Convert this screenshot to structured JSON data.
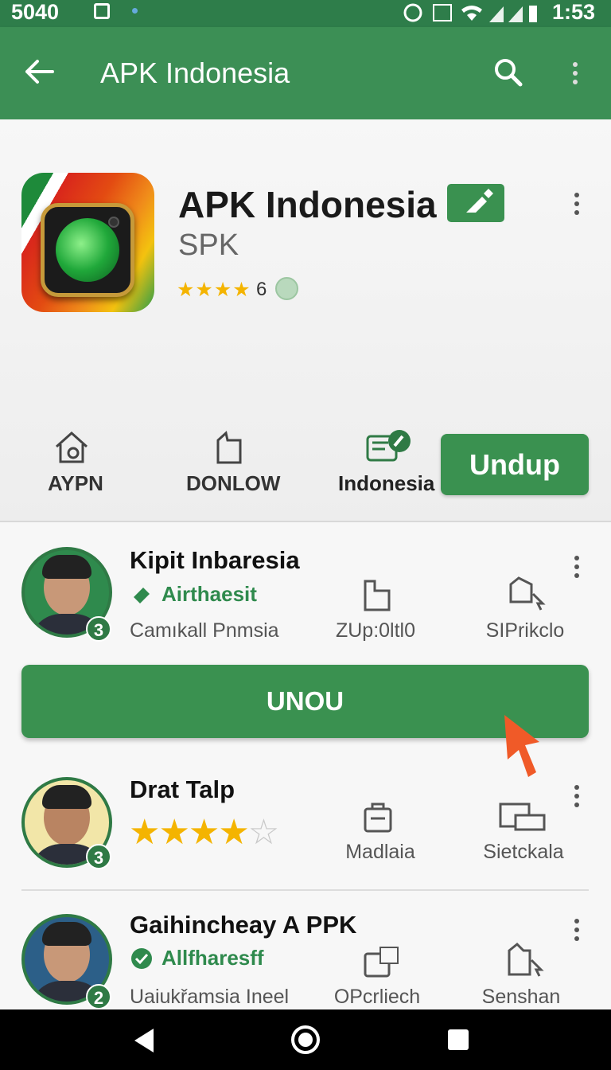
{
  "status_bar": {
    "left": "5040",
    "time": "1:53"
  },
  "app_bar": {
    "title": "APK Indonesia",
    "back": "back-icon",
    "search": "search-icon",
    "menu": "more-icon"
  },
  "app": {
    "name": "APK Indonesia",
    "developer": "SPK",
    "rating": "6",
    "star_count": 4,
    "tabs": [
      {
        "label": "AYPN",
        "icon": "home-icon"
      },
      {
        "label": "DONLOW",
        "icon": "page-icon"
      },
      {
        "label": "Indonesia",
        "icon": "edit-icon"
      }
    ],
    "install_label": "Undup"
  },
  "items": [
    {
      "name": "Kipit Inbaresia",
      "tag": "Airthaesit",
      "desc": "Camıkall Pnmsia",
      "col1": "ZUp:0ltl0",
      "col2": "SIPrikclo",
      "badge": "3"
    },
    {
      "name": "Drat Talp",
      "stars": 4,
      "col1": "Madlaia",
      "col2": "Sietckala",
      "badge": "3"
    },
    {
      "name": "Gaihincheay A PPK",
      "tag": "Allfharesff",
      "desc": "Uaiukřamsia Ineel",
      "col1": "OPcrliech",
      "col2": "Senshan",
      "badge": "2"
    }
  ],
  "primary_button": "UNOU",
  "colors": {
    "primary": "#3c8f55",
    "dark": "#2e7d4a",
    "accent": "#f05a28",
    "star": "#f4b400"
  }
}
